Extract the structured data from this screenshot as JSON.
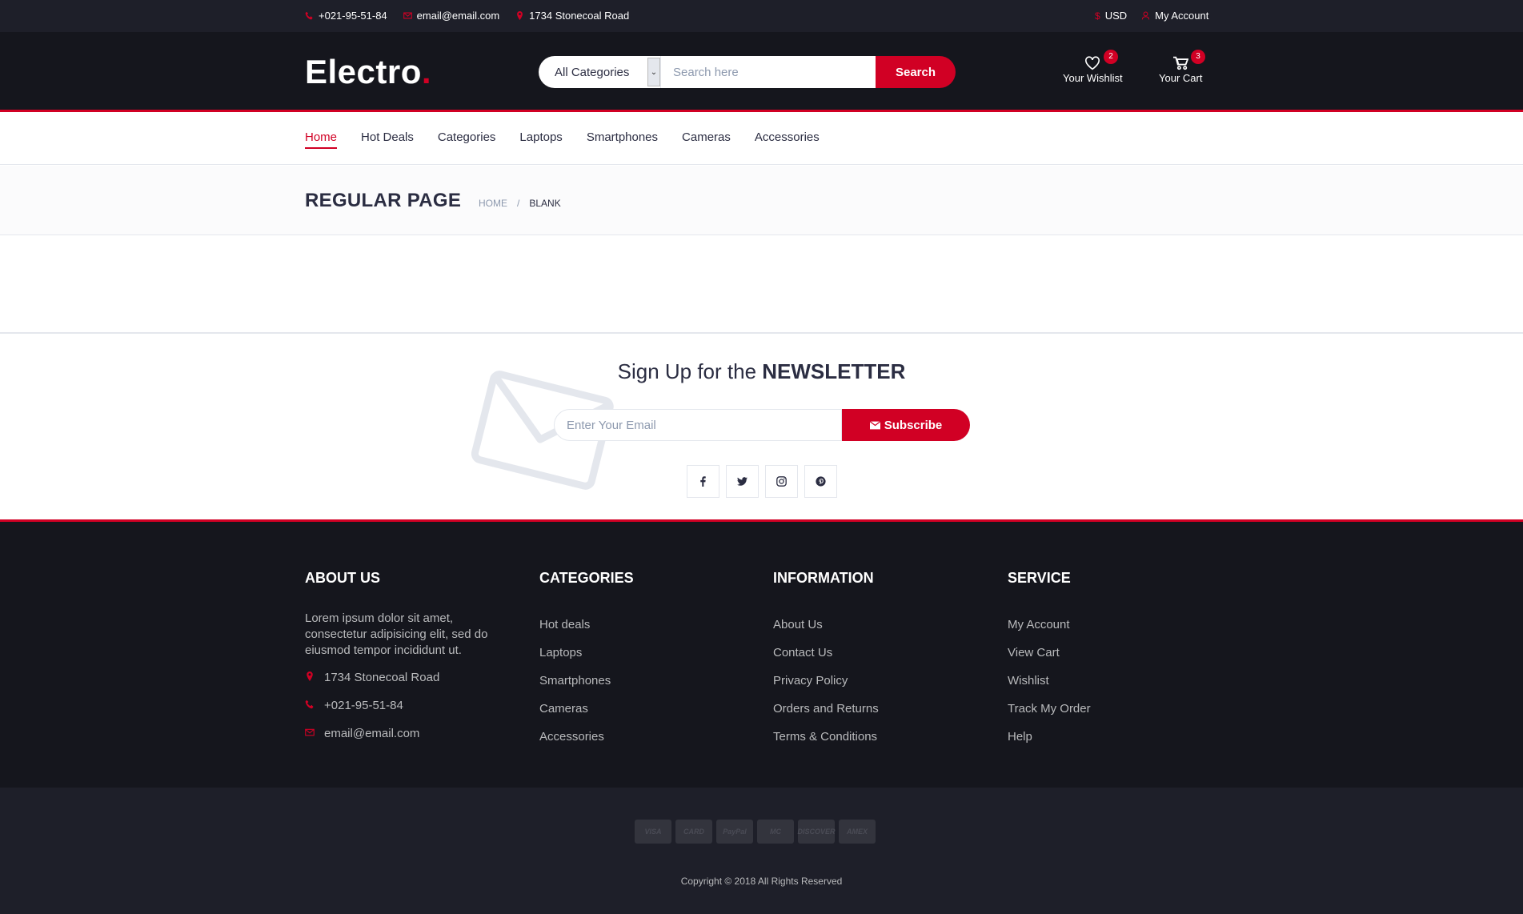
{
  "topbar": {
    "phone": "+021-95-51-84",
    "email": "email@email.com",
    "address": "1734 Stonecoal Road",
    "currency": "USD",
    "account": "My Account"
  },
  "header": {
    "logo": "Electro",
    "logo_dot": ".",
    "category_select": "All Categories",
    "search_placeholder": "Search here",
    "search_button": "Search",
    "wishlist_label": "Your Wishlist",
    "wishlist_count": "2",
    "cart_label": "Your Cart",
    "cart_count": "3"
  },
  "nav": {
    "items": [
      "Home",
      "Hot Deals",
      "Categories",
      "Laptops",
      "Smartphones",
      "Cameras",
      "Accessories"
    ],
    "active": "Home"
  },
  "breadcrumb": {
    "title": "REGULAR PAGE",
    "home": "HOME",
    "separator": "/",
    "current": "BLANK"
  },
  "newsletter": {
    "title_prefix": "Sign Up for the ",
    "title_bold": "NEWSLETTER",
    "email_placeholder": "Enter Your Email",
    "subscribe_button": "Subscribe"
  },
  "footer": {
    "about": {
      "title": "About Us",
      "text": "Lorem ipsum dolor sit amet, consectetur adipisicing elit, sed do eiusmod tempor incididunt ut.",
      "address": "1734 Stonecoal Road",
      "phone": "+021-95-51-84",
      "email": "email@email.com"
    },
    "categories": {
      "title": "Categories",
      "items": [
        "Hot deals",
        "Laptops",
        "Smartphones",
        "Cameras",
        "Accessories"
      ]
    },
    "information": {
      "title": "Information",
      "items": [
        "About Us",
        "Contact Us",
        "Privacy Policy",
        "Orders and Returns",
        "Terms & Conditions"
      ]
    },
    "service": {
      "title": "Service",
      "items": [
        "My Account",
        "View Cart",
        "Wishlist",
        "Track My Order",
        "Help"
      ]
    }
  },
  "bottom": {
    "payments": [
      "VISA",
      "CARD",
      "PayPal",
      "MC",
      "DISCOVER",
      "AMEX"
    ],
    "copyright": "Copyright © 2018 All Rights Reserved"
  },
  "colors": {
    "accent": "#d10024",
    "dark": "#15161d",
    "darker": "#1e1f29"
  }
}
